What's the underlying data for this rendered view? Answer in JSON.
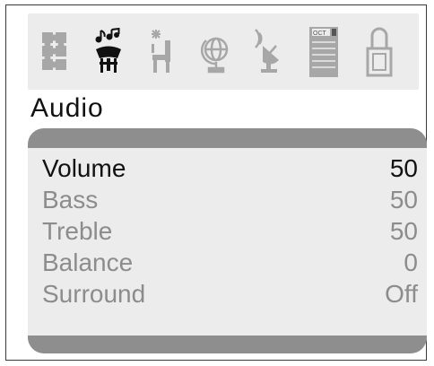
{
  "menu": {
    "icons": [
      {
        "name": "picture-puzzle-icon",
        "selected": false
      },
      {
        "name": "audio-music-icon",
        "selected": true
      },
      {
        "name": "setup-chair-icon",
        "selected": false
      },
      {
        "name": "globe-icon",
        "selected": false
      },
      {
        "name": "satellite-dish-icon",
        "selected": false
      },
      {
        "name": "channel-list-icon",
        "selected": false
      },
      {
        "name": "lock-icon",
        "selected": false
      }
    ],
    "channel_badge": "OCT"
  },
  "section_title": "Audio",
  "settings": [
    {
      "label": "Volume",
      "value": "50",
      "state": "active"
    },
    {
      "label": "Bass",
      "value": "50",
      "state": "inactive"
    },
    {
      "label": "Treble",
      "value": "50",
      "state": "inactive"
    },
    {
      "label": "Balance",
      "value": "0",
      "state": "inactive"
    },
    {
      "label": "Surround",
      "value": "Off",
      "state": "inactive"
    }
  ],
  "colors": {
    "active_text": "#111111",
    "inactive_text": "#8c8c8c",
    "panel_bar": "#8e8e8e",
    "panel_bg": "#ececec"
  }
}
